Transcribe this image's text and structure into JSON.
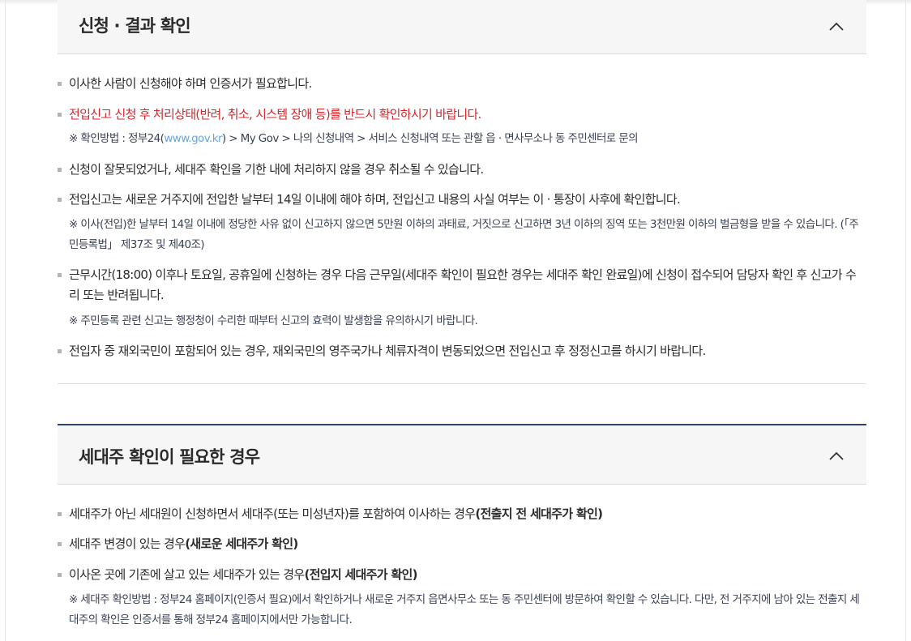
{
  "section1": {
    "title": "신청 · 결과 확인",
    "toggle_icon": "chevron-up-icon",
    "items": [
      {
        "text": "이사한 사람이 신청해야 하며 인증서가 필요합니다."
      },
      {
        "text": "전입신고 신청 후 처리상태(반려, 취소, 시스템 장애 등)를 반드시 확인하시기 바랍니다.",
        "color": "#d6262b"
      },
      {
        "note_prefix": "※ 확인방법 : 정부24(",
        "note_link": "www.gov.kr",
        "note_suffix": ") > My Gov > 나의 신청내역 > 서비스 신청내역 또는 관할 읍 · 면사무소나 동 주민센터로 문의"
      },
      {
        "text": "신청이 잘못되었거나, 세대주 확인을 기한 내에 처리하지 않을 경우 취소될 수 있습니다."
      },
      {
        "text": "전입신고는 새로운 거주지에 전입한 날부터 14일 이내에 해야 하며, 전입신고 내용의 사실 여부는 이 · 통장이 사후에 확인합니다."
      },
      {
        "note": "※ 이사(전입)한 날부터 14일 이내에 정당한 사유 없이 신고하지 않으면 5만원 이하의 과태료, 거짓으로 신고하면 3년 이하의 징역 또는 3천만원 이하의 벌금형을 받을 수 있습니다. (「주민등록법」 제37조 및 제40조)"
      },
      {
        "text": "근무시간(18:00) 이후나 토요일, 공휴일에 신청하는 경우 다음 근무일(세대주 확인이 필요한 경우는 세대주 확인 완료일)에 신청이 접수되어 담당자 확인 후 신고가 수리 또는 반려됩니다."
      },
      {
        "note": "※ 주민등록 관련 신고는 행정청이 수리한 때부터 신고의 효력이 발생함을 유의하시기 바랍니다."
      },
      {
        "text": "전입자 중 재외국민이 포함되어 있는 경우, 재외국민의 영주국가나 체류자격이 변동되었으면 전입신고 후 정정신고를 하시기 바랍니다."
      }
    ]
  },
  "section2": {
    "title": "세대주 확인이 필요한 경우",
    "toggle_icon": "chevron-up-icon",
    "items": [
      {
        "text": "세대주가 아닌 세대원이 신청하면서 세대주(또는 미성년자)를 포함하여 이사하는 경우",
        "bold": "(전출지 전 세대주가 확인)"
      },
      {
        "text": "세대주 변경이 있는 경우",
        "bold": "(새로운 세대주가 확인)"
      },
      {
        "text": "이사온 곳에 기존에 살고 있는 세대주가 있는 경우",
        "bold": "(전입지 세대주가 확인)"
      },
      {
        "note": "※ 세대주 확인방법 : 정부24 홈페이지(인증서 필요)에서 확인하거나 새로운 거주지 읍면사무소 또는 동 주민센터에 방문하여 확인할 수 있습니다. 다만, 전 거주지에 남아 있는 전출지 세대주의 확인은 인증서를 통해 정부24 홈페이지에서만 가능합니다."
      }
    ]
  },
  "colors": {
    "accent": "#2f3f6e",
    "warning": "#d6262b",
    "link": "#6aa6e0"
  }
}
